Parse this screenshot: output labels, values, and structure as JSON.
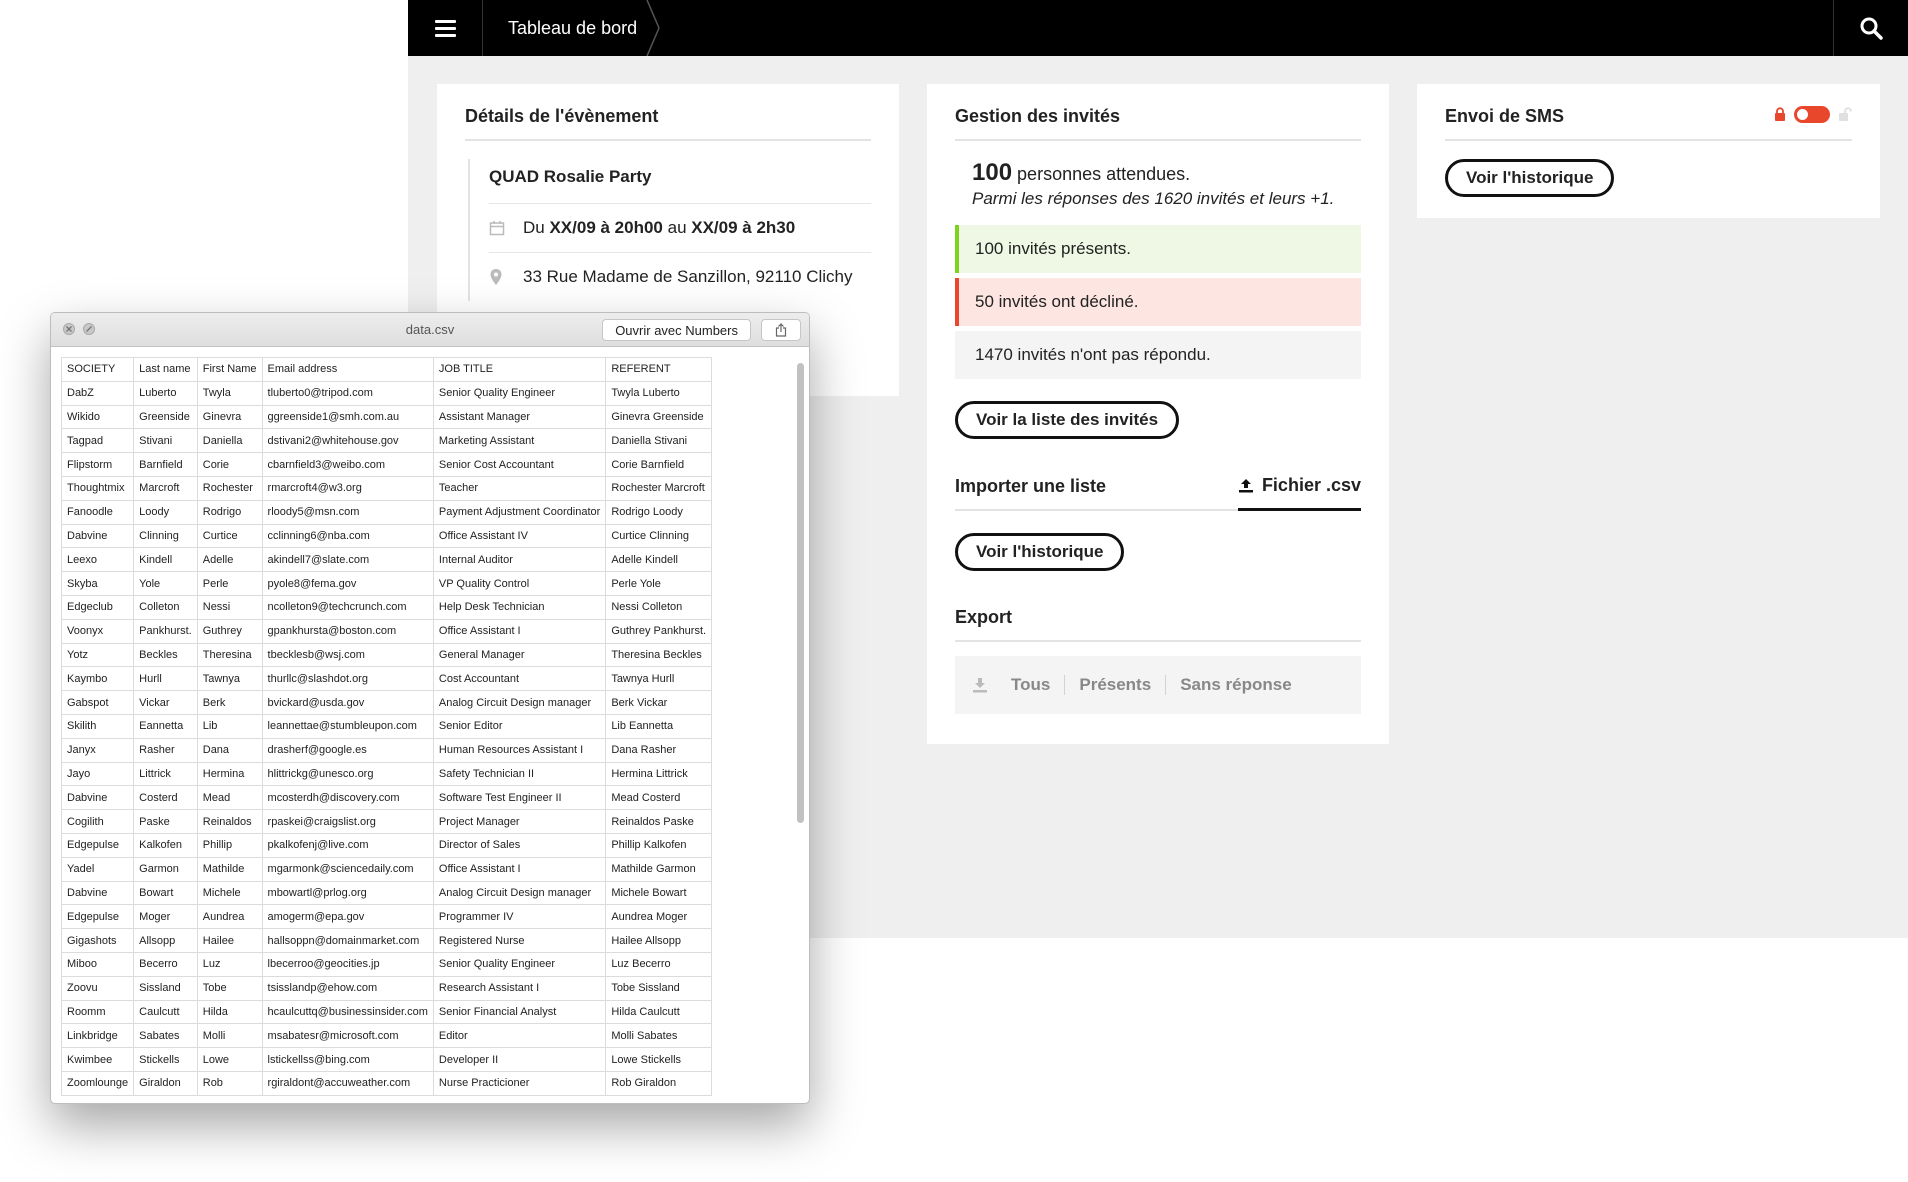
{
  "header": {
    "breadcrumb": "Tableau de bord"
  },
  "event": {
    "title": "Détails de l'évènement",
    "name": "QUAD Rosalie Party",
    "date_prefix": "Du ",
    "date_start": "XX/09 à 20h00",
    "date_mid": " au ",
    "date_end": "XX/09 à 2h30",
    "address": "33 Rue Madame de Sanzillon, 92110 Clichy"
  },
  "guests": {
    "title": "Gestion des invités",
    "expected_count": "100",
    "expected_label": " personnes attendues.",
    "responses_note": "Parmi les réponses des 1620 invités et leurs +1.",
    "present": "100 invités présents.",
    "declined": "50 invités ont décliné.",
    "no_answer": "1470 invités n'ont pas répondu.",
    "list_button": "Voir la liste des invités",
    "import_title": "Importer une liste",
    "csv_button": "Fichier .csv",
    "history_button": "Voir l'historique",
    "export_title": "Export",
    "export_options": [
      "Tous",
      "Présents",
      "Sans réponse"
    ]
  },
  "sms": {
    "title": "Envoi de SMS",
    "history_button": "Voir l'historique",
    "toggle_color": "#e8472b"
  },
  "csv_window": {
    "title": "data.csv",
    "open_button": "Ouvrir avec Numbers",
    "headers": [
      "SOCIETY",
      "Last name",
      "First Name",
      "Email address",
      "JOB TITLE",
      "REFERENT"
    ],
    "rows": [
      [
        "DabZ",
        "Luberto",
        "Twyla",
        "tluberto0@tripod.com",
        "Senior Quality Engineer",
        "Twyla Luberto"
      ],
      [
        "Wikido",
        "Greenside",
        "Ginevra",
        "ggreenside1@smh.com.au",
        "Assistant Manager",
        "Ginevra Greenside"
      ],
      [
        "Tagpad",
        "Stivani",
        "Daniella",
        "dstivani2@whitehouse.gov",
        "Marketing Assistant",
        "Daniella Stivani"
      ],
      [
        "Flipstorm",
        "Barnfield",
        "Corie",
        "cbarnfield3@weibo.com",
        "Senior Cost Accountant",
        "Corie Barnfield"
      ],
      [
        "Thoughtmix",
        "Marcroft",
        "Rochester",
        "rmarcroft4@w3.org",
        "Teacher",
        "Rochester Marcroft"
      ],
      [
        "Fanoodle",
        "Loody",
        "Rodrigo",
        "rloody5@msn.com",
        "Payment Adjustment Coordinator",
        "Rodrigo Loody"
      ],
      [
        "Dabvine",
        "Clinning",
        "Curtice",
        "cclinning6@nba.com",
        "Office Assistant IV",
        "Curtice Clinning"
      ],
      [
        "Leexo",
        "Kindell",
        "Adelle",
        "akindell7@slate.com",
        "Internal Auditor",
        "Adelle Kindell"
      ],
      [
        "Skyba",
        "Yole",
        "Perle",
        "pyole8@fema.gov",
        "VP Quality Control",
        "Perle Yole"
      ],
      [
        "Edgeclub",
        "Colleton",
        "Nessi",
        "ncolleton9@techcrunch.com",
        "Help Desk Technician",
        "Nessi Colleton"
      ],
      [
        "Voonyx",
        "Pankhurst.",
        "Guthrey",
        "gpankhursta@boston.com",
        "Office Assistant I",
        "Guthrey Pankhurst."
      ],
      [
        "Yotz",
        "Beckles",
        "Theresina",
        "tbecklesb@wsj.com",
        "General Manager",
        "Theresina Beckles"
      ],
      [
        "Kaymbo",
        "Hurll",
        "Tawnya",
        "thurllc@slashdot.org",
        "Cost Accountant",
        "Tawnya Hurll"
      ],
      [
        "Gabspot",
        "Vickar",
        "Berk",
        "bvickard@usda.gov",
        "Analog Circuit Design manager",
        "Berk Vickar"
      ],
      [
        "Skilith",
        "Eannetta",
        "Lib",
        "leannettae@stumbleupon.com",
        "Senior Editor",
        "Lib Eannetta"
      ],
      [
        "Janyx",
        "Rasher",
        "Dana",
        "drasherf@google.es",
        "Human Resources Assistant I",
        "Dana Rasher"
      ],
      [
        "Jayo",
        "Littrick",
        "Hermina",
        "hlittrickg@unesco.org",
        "Safety Technician II",
        "Hermina Littrick"
      ],
      [
        "Dabvine",
        "Costerd",
        "Mead",
        "mcosterdh@discovery.com",
        "Software Test Engineer II",
        "Mead Costerd"
      ],
      [
        "Cogilith",
        "Paske",
        "Reinaldos",
        "rpaskei@craigslist.org",
        "Project Manager",
        "Reinaldos Paske"
      ],
      [
        "Edgepulse",
        "Kalkofen",
        "Phillip",
        "pkalkofenj@live.com",
        "Director of Sales",
        "Phillip Kalkofen"
      ],
      [
        "Yadel",
        "Garmon",
        "Mathilde",
        "mgarmonk@sciencedaily.com",
        "Office Assistant I",
        "Mathilde Garmon"
      ],
      [
        "Dabvine",
        "Bowart",
        "Michele",
        "mbowartl@prlog.org",
        "Analog Circuit Design manager",
        "Michele Bowart"
      ],
      [
        "Edgepulse",
        "Moger",
        "Aundrea",
        "amogerm@epa.gov",
        "Programmer IV",
        "Aundrea Moger"
      ],
      [
        "Gigashots",
        "Allsopp",
        "Hailee",
        "hallsoppn@domainmarket.com",
        "Registered Nurse",
        "Hailee Allsopp"
      ],
      [
        "Miboo",
        "Becerro",
        "Luz",
        "lbecerroo@geocities.jp",
        "Senior Quality Engineer",
        "Luz Becerro"
      ],
      [
        "Zoovu",
        "Sissland",
        "Tobe",
        "tsisslandp@ehow.com",
        "Research Assistant I",
        "Tobe Sissland"
      ],
      [
        "Roomm",
        "Caulcutt",
        "Hilda",
        "hcaulcuttq@businessinsider.com",
        "Senior Financial Analyst",
        "Hilda Caulcutt"
      ],
      [
        "Linkbridge",
        "Sabates",
        "Molli",
        "msabatesr@microsoft.com",
        "Editor",
        "Molli Sabates"
      ],
      [
        "Kwimbee",
        "Stickells",
        "Lowe",
        "lstickellss@bing.com",
        "Developer II",
        "Lowe Stickells"
      ],
      [
        "Zoomlounge",
        "Giraldon",
        "Rob",
        "rgiraldont@accuweather.com",
        "Nurse Practicioner",
        "Rob Giraldon"
      ]
    ]
  }
}
